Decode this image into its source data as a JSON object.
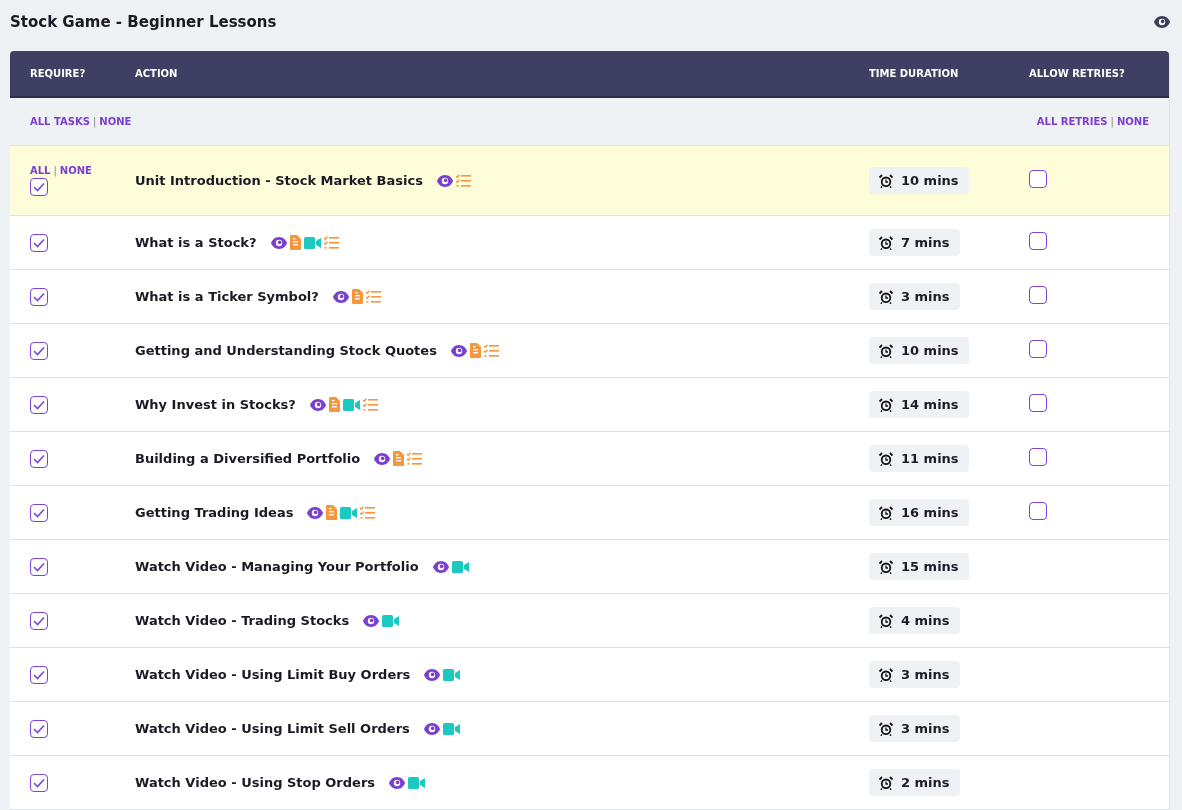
{
  "page_title": "Stock Game - Beginner Lessons",
  "columns": [
    "REQUIRE?",
    "ACTION",
    "TIME DURATION",
    "ALLOW RETRIES?"
  ],
  "filter_row": {
    "separator": "|",
    "tasks_links": [
      "ALL TASKS",
      "NONE"
    ],
    "retries_links": [
      "ALL RETRIES",
      "NONE"
    ]
  },
  "rows": [
    {
      "title": "Unit Introduction - Stock Market Basics",
      "highlighted": true,
      "row_links": [
        "ALL",
        "NONE"
      ],
      "required": true,
      "icons": [
        {
          "kind": "view"
        },
        {
          "kind": "quiz"
        }
      ],
      "duration": "10 mins",
      "retries": false
    },
    {
      "title": "What is a Stock?",
      "highlighted": false,
      "required": true,
      "icons": [
        {
          "kind": "view"
        },
        {
          "kind": "doc"
        },
        {
          "kind": "video"
        },
        {
          "kind": "quiz"
        }
      ],
      "duration": "7 mins",
      "retries": false
    },
    {
      "title": "What is a Ticker Symbol?",
      "highlighted": false,
      "required": true,
      "icons": [
        {
          "kind": "view"
        },
        {
          "kind": "doc"
        },
        {
          "kind": "quiz"
        }
      ],
      "duration": "3 mins",
      "retries": false
    },
    {
      "title": "Getting and Understanding Stock Quotes",
      "highlighted": false,
      "required": true,
      "icons": [
        {
          "kind": "view"
        },
        {
          "kind": "doc"
        },
        {
          "kind": "quiz"
        }
      ],
      "duration": "10 mins",
      "retries": false
    },
    {
      "title": "Why Invest in Stocks?",
      "highlighted": false,
      "required": true,
      "icons": [
        {
          "kind": "view"
        },
        {
          "kind": "doc"
        },
        {
          "kind": "video"
        },
        {
          "kind": "quiz"
        }
      ],
      "duration": "14 mins",
      "retries": false
    },
    {
      "title": "Building a Diversified Portfolio",
      "highlighted": false,
      "required": true,
      "icons": [
        {
          "kind": "view"
        },
        {
          "kind": "doc"
        },
        {
          "kind": "quiz"
        }
      ],
      "duration": "11 mins",
      "retries": false
    },
    {
      "title": "Getting Trading Ideas",
      "highlighted": false,
      "required": true,
      "icons": [
        {
          "kind": "view"
        },
        {
          "kind": "doc"
        },
        {
          "kind": "video"
        },
        {
          "kind": "quiz"
        }
      ],
      "duration": "16 mins",
      "retries": false
    },
    {
      "title": "Watch Video - Managing Your Portfolio",
      "highlighted": false,
      "required": true,
      "icons": [
        {
          "kind": "view"
        },
        {
          "kind": "video"
        }
      ],
      "duration": "15 mins"
    },
    {
      "title": "Watch Video - Trading Stocks",
      "highlighted": false,
      "required": true,
      "icons": [
        {
          "kind": "view"
        },
        {
          "kind": "video"
        }
      ],
      "duration": "4 mins"
    },
    {
      "title": "Watch Video - Using Limit Buy Orders",
      "highlighted": false,
      "required": true,
      "icons": [
        {
          "kind": "view"
        },
        {
          "kind": "video"
        }
      ],
      "duration": "3 mins"
    },
    {
      "title": "Watch Video - Using Limit Sell Orders",
      "highlighted": false,
      "required": true,
      "icons": [
        {
          "kind": "view"
        },
        {
          "kind": "video"
        }
      ],
      "duration": "3 mins"
    },
    {
      "title": "Watch Video - Using Stop Orders",
      "highlighted": false,
      "required": true,
      "icons": [
        {
          "kind": "view"
        },
        {
          "kind": "video"
        }
      ],
      "duration": "2 mins"
    }
  ]
}
